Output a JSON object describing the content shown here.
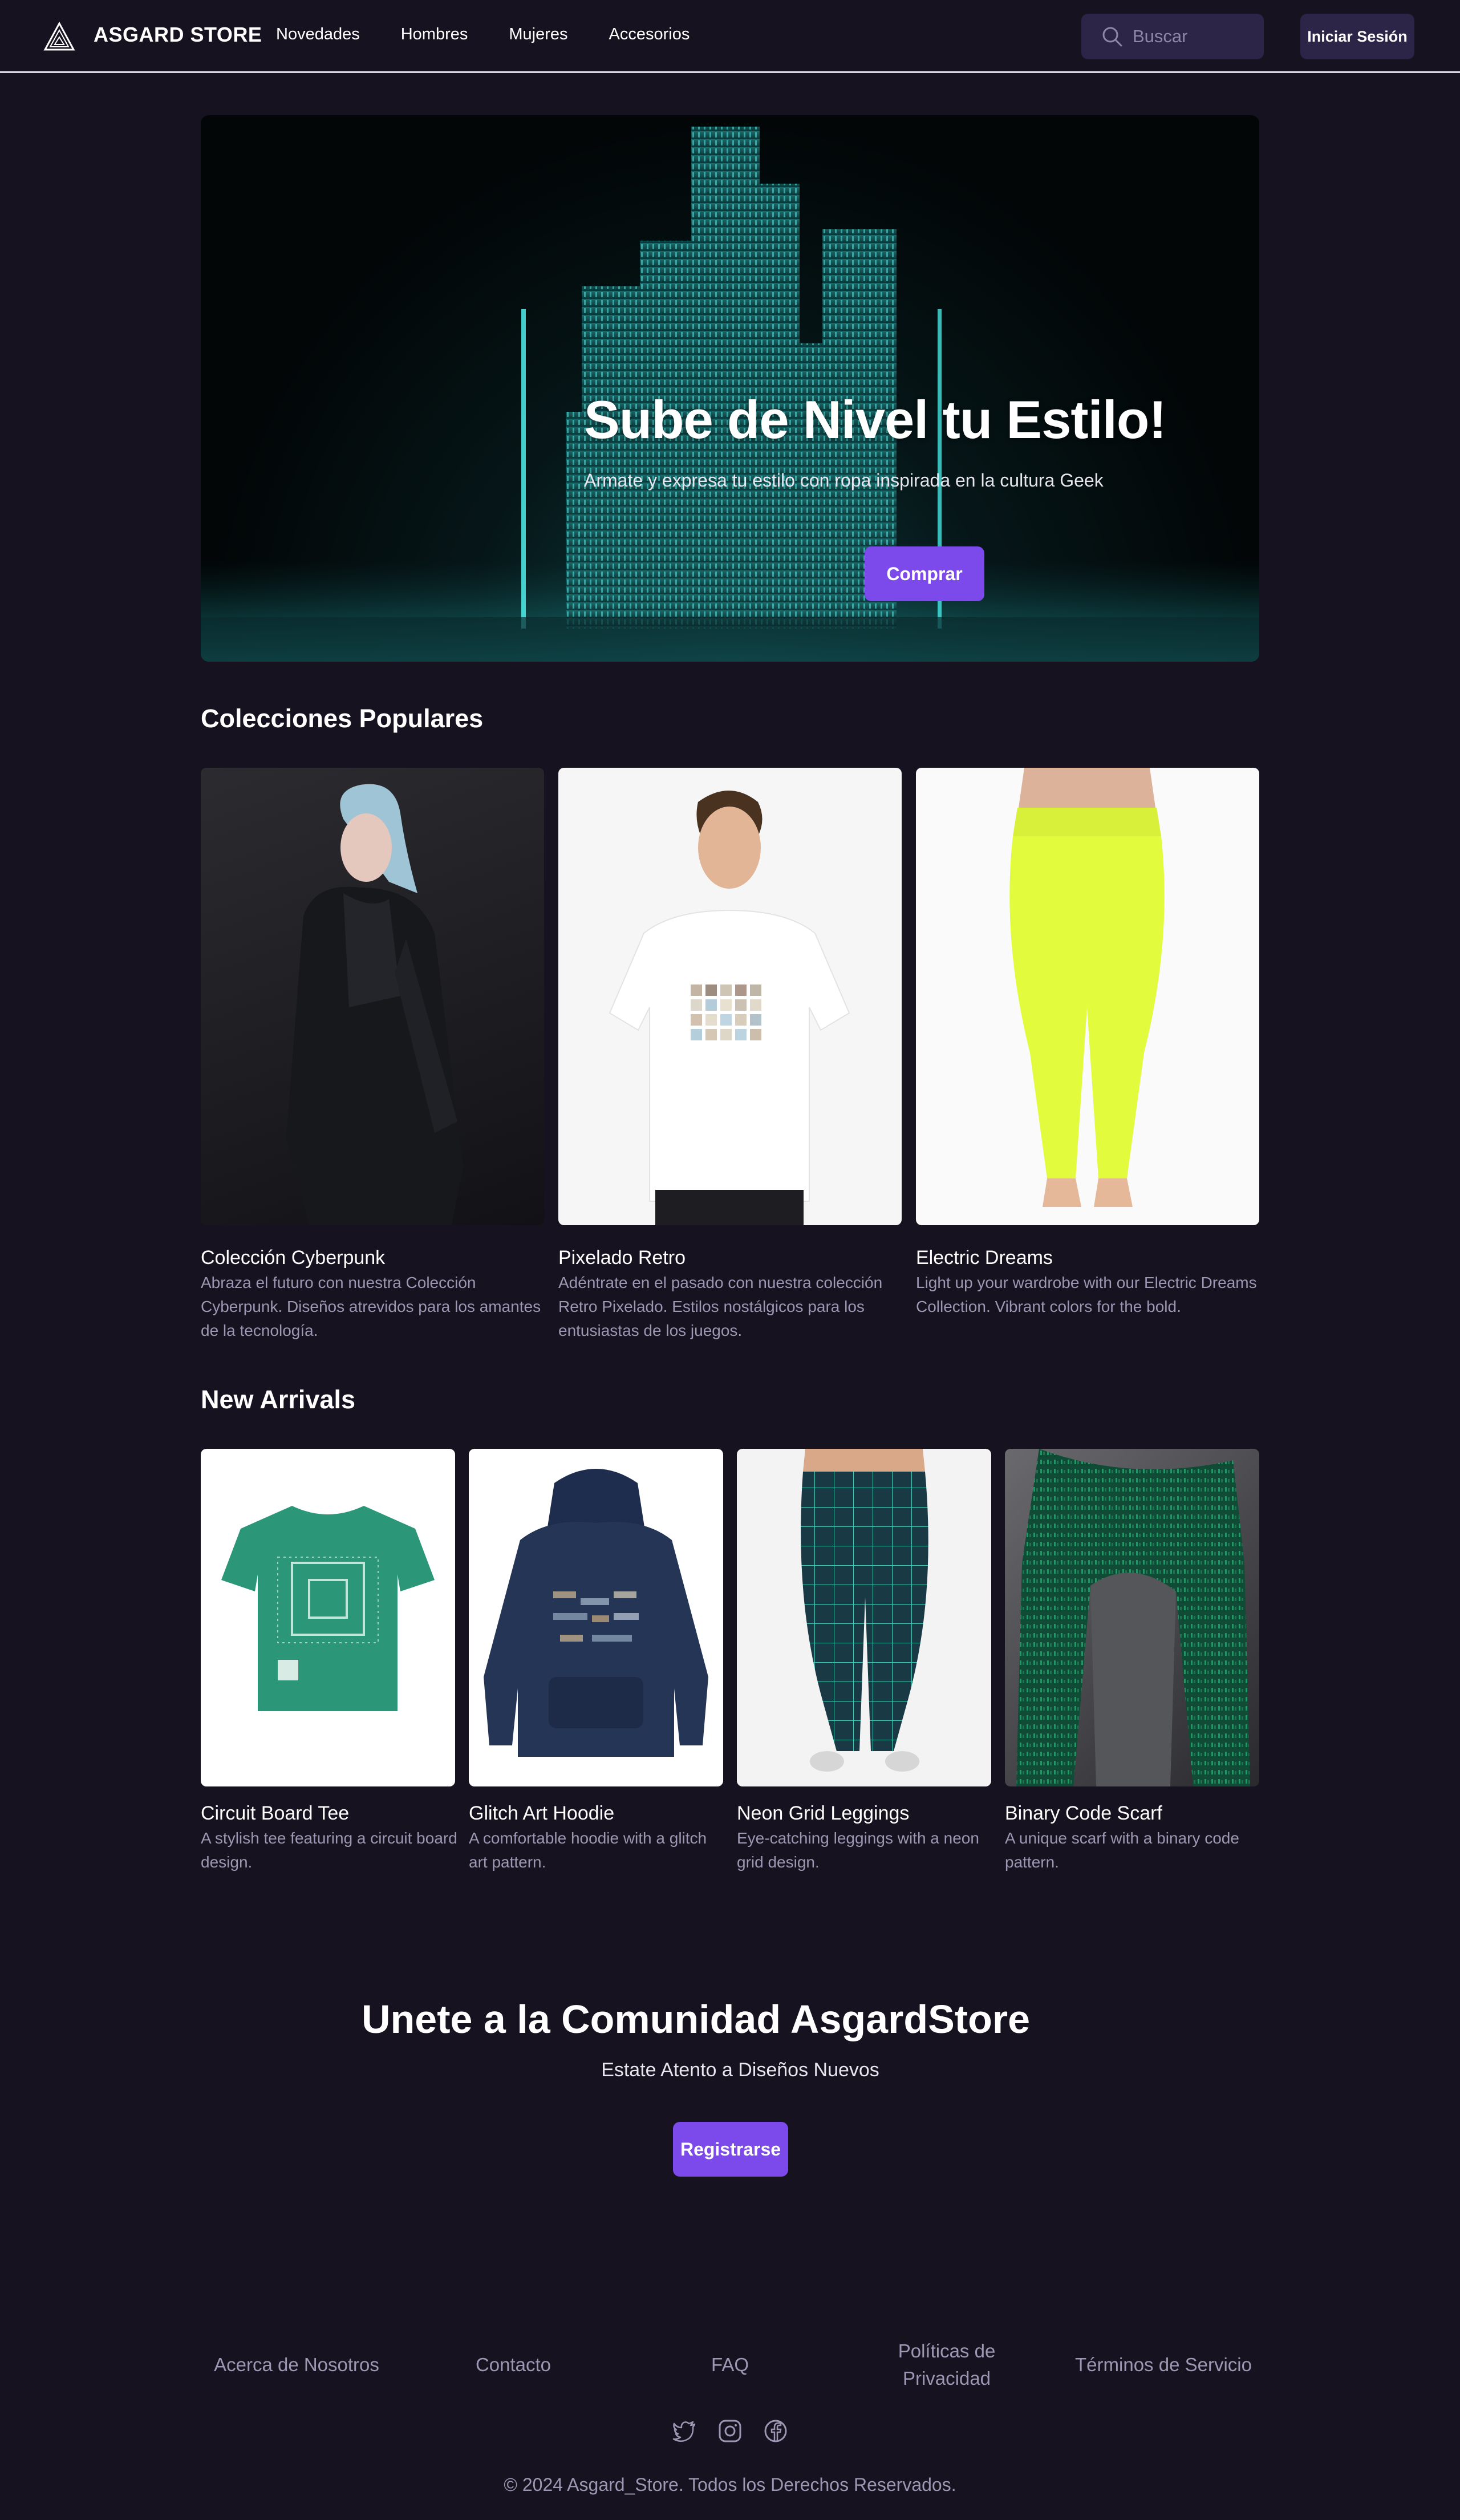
{
  "header": {
    "brand": "ASGARD STORE",
    "nav": [
      "Novedades",
      "Hombres",
      "Mujeres",
      "Accesorios"
    ],
    "search_placeholder": "Buscar",
    "login_label": "Iniciar Sesión"
  },
  "hero": {
    "title": "Sube de Nivel tu Estilo!",
    "subtitle": "Armate y expresa tu estilo con ropa inspirada en la cultura Geek",
    "cta_label": "Comprar"
  },
  "collections": {
    "title": "Colecciones Populares",
    "items": [
      {
        "name": "Colección Cyberpunk",
        "description": "Abraza el futuro con nuestra Colección Cyberpunk. Diseños atrevidos para los amantes de la tecnología."
      },
      {
        "name": "Pixelado Retro",
        "description": "Adéntrate en el pasado con nuestra colección Retro Pixelado. Estilos nostálgicos para los entusiastas de los juegos."
      },
      {
        "name": "Electric Dreams",
        "description": "Light up your wardrobe with our Electric Dreams Collection. Vibrant colors for the bold."
      }
    ]
  },
  "new_arrivals": {
    "title": "New Arrivals",
    "items": [
      {
        "name": "Circuit Board Tee",
        "description": "A stylish tee featuring a circuit board design."
      },
      {
        "name": "Glitch Art Hoodie",
        "description": "A comfortable hoodie with a glitch art pattern."
      },
      {
        "name": "Neon Grid Leggings",
        "description": "Eye-catching leggings with a neon grid design."
      },
      {
        "name": "Binary Code Scarf",
        "description": "A unique scarf with a binary code pattern."
      }
    ]
  },
  "community": {
    "title": "Unete a la Comunidad AsgardStore",
    "subtitle": "Estate Atento a Diseños Nuevos",
    "cta_label": "Registrarse"
  },
  "footer": {
    "links": [
      "Acerca de Nosotros",
      "Contacto",
      "FAQ",
      "Políticas de Privacidad",
      "Términos de Servicio"
    ],
    "social_icons": [
      "twitter-icon",
      "instagram-icon",
      "facebook-icon"
    ],
    "copyright": "© 2024 Asgard_Store. Todos los Derechos Reservados."
  },
  "colors": {
    "background": "#16121f",
    "accent": "#7c49ea",
    "muted_text": "#9d97b3",
    "input_bg": "#2c2548"
  }
}
